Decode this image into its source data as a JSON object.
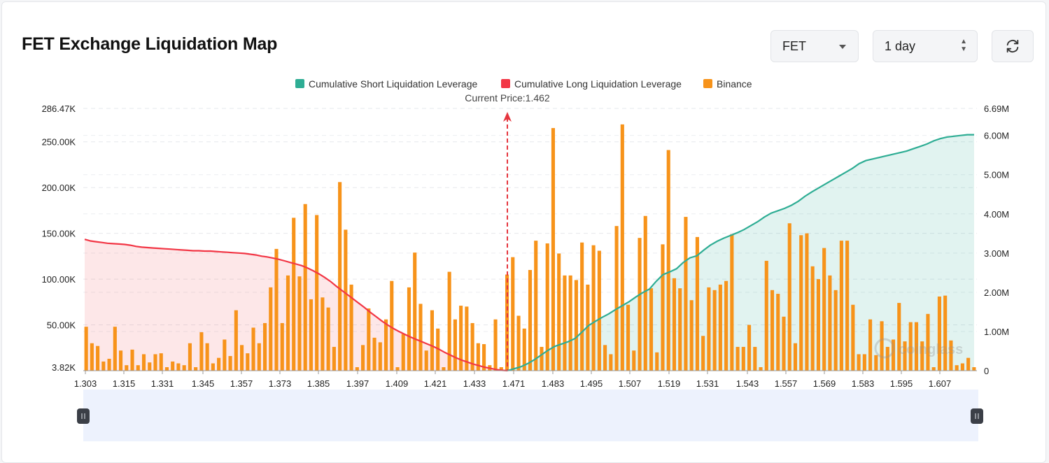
{
  "header": {
    "title": "FET Exchange Liquidation Map",
    "coin_select": {
      "value": "FET"
    },
    "period_select": {
      "value": "1 day"
    },
    "refresh_icon": "refresh-icon"
  },
  "legend": [
    {
      "label": "Cumulative Short Liquidation Leverage",
      "color": "#2ead94"
    },
    {
      "label": "Cumulative Long Liquidation Leverage",
      "color": "#f23645"
    },
    {
      "label": "Binance",
      "color": "#f7931a"
    }
  ],
  "current_price_label": "Current Price:1.462",
  "watermark": "coinglass",
  "chart_data": {
    "type": "bar",
    "title": "FET Exchange Liquidation Map",
    "current_price": 1.462,
    "x_tick_labels": [
      "1.303",
      "1.315",
      "1.331",
      "1.345",
      "1.357",
      "1.373",
      "1.385",
      "1.397",
      "1.409",
      "1.421",
      "1.433",
      "1.471",
      "1.483",
      "1.495",
      "1.507",
      "1.519",
      "1.531",
      "1.543",
      "1.557",
      "1.569",
      "1.583",
      "1.595",
      "1.607"
    ],
    "y_left": {
      "ticks": [
        "3.82K",
        "50.00K",
        "100.00K",
        "150.00K",
        "200.00K",
        "250.00K",
        "286.47K"
      ],
      "range": [
        3820,
        286470
      ]
    },
    "y_right": {
      "ticks": [
        "0",
        "1.00M",
        "2.00M",
        "3.00M",
        "4.00M",
        "5.00M",
        "6.00M",
        "6.69M"
      ],
      "range": [
        0,
        6690000
      ]
    },
    "bars_binance": [
      48000,
      30000,
      27000,
      10000,
      13000,
      48000,
      22000,
      6000,
      23000,
      6000,
      18000,
      9000,
      18000,
      19000,
      3820,
      10000,
      8000,
      6000,
      30000,
      3820,
      42000,
      30000,
      8000,
      14000,
      34000,
      16000,
      66000,
      28000,
      19000,
      47000,
      30000,
      52000,
      91000,
      133000,
      52000,
      104000,
      167000,
      103000,
      182000,
      78000,
      170000,
      80000,
      69000,
      26000,
      206000,
      154000,
      94000,
      3820,
      28000,
      68000,
      36000,
      31000,
      56000,
      98000,
      3820,
      40000,
      91000,
      129000,
      73000,
      22000,
      66000,
      46000,
      3820,
      108000,
      56000,
      71000,
      70000,
      52000,
      30000,
      29000,
      6000,
      56000,
      3820,
      105000,
      124000,
      60000,
      46000,
      110000,
      142000,
      26000,
      139000,
      265000,
      128000,
      104000,
      104000,
      99000,
      140000,
      94000,
      137000,
      131000,
      28000,
      18000,
      158000,
      269000,
      72000,
      22000,
      145000,
      169000,
      90000,
      20000,
      138000,
      241000,
      101000,
      90000,
      168000,
      77000,
      146000,
      38000,
      91000,
      88000,
      94000,
      98000,
      149000,
      26000,
      26000,
      50000,
      26000,
      3820,
      120000,
      88000,
      84000,
      59000,
      161000,
      30000,
      148000,
      150000,
      114000,
      100000,
      134000,
      104000,
      88000,
      142000,
      142000,
      72000,
      18000,
      18000,
      56000,
      17000,
      54000,
      26000,
      34000,
      74000,
      32000,
      53000,
      53000,
      32000,
      62000,
      3820,
      81000,
      82000,
      33000,
      6000,
      8000,
      14000,
      3820
    ],
    "long_cumulative": [
      3.35,
      3.31,
      3.29,
      3.27,
      3.25,
      3.24,
      3.23,
      3.22,
      3.2,
      3.17,
      3.15,
      3.14,
      3.13,
      3.12,
      3.11,
      3.1,
      3.09,
      3.08,
      3.07,
      3.06,
      3.06,
      3.05,
      3.05,
      3.04,
      3.03,
      3.02,
      3.01,
      3.0,
      2.99,
      2.97,
      2.95,
      2.92,
      2.9,
      2.87,
      2.84,
      2.8,
      2.76,
      2.72,
      2.68,
      2.62,
      2.55,
      2.47,
      2.38,
      2.28,
      2.16,
      2.05,
      1.94,
      1.83,
      1.72,
      1.61,
      1.49,
      1.38,
      1.27,
      1.17,
      1.08,
      1.0,
      0.93,
      0.86,
      0.8,
      0.74,
      0.68,
      0.62,
      0.55,
      0.47,
      0.4,
      0.33,
      0.27,
      0.22,
      0.17,
      0.13,
      0.09,
      0.06,
      0.03,
      0.01,
      0.0
    ],
    "short_cumulative": [
      0.0,
      0.05,
      0.1,
      0.18,
      0.28,
      0.4,
      0.52,
      0.62,
      0.68,
      0.74,
      0.82,
      0.98,
      1.15,
      1.26,
      1.36,
      1.45,
      1.56,
      1.66,
      1.76,
      1.88,
      1.99,
      2.08,
      2.28,
      2.45,
      2.52,
      2.6,
      2.76,
      2.88,
      2.93,
      3.07,
      3.2,
      3.3,
      3.38,
      3.45,
      3.52,
      3.6,
      3.7,
      3.8,
      3.92,
      4.02,
      4.08,
      4.14,
      4.22,
      4.32,
      4.45,
      4.56,
      4.66,
      4.76,
      4.86,
      4.96,
      5.06,
      5.16,
      5.28,
      5.36,
      5.4,
      5.44,
      5.48,
      5.52,
      5.56,
      5.6,
      5.66,
      5.72,
      5.78,
      5.86,
      5.92,
      5.96,
      5.98,
      6.0,
      6.02,
      6.02
    ]
  },
  "y_axis_units_note_hidden": ""
}
